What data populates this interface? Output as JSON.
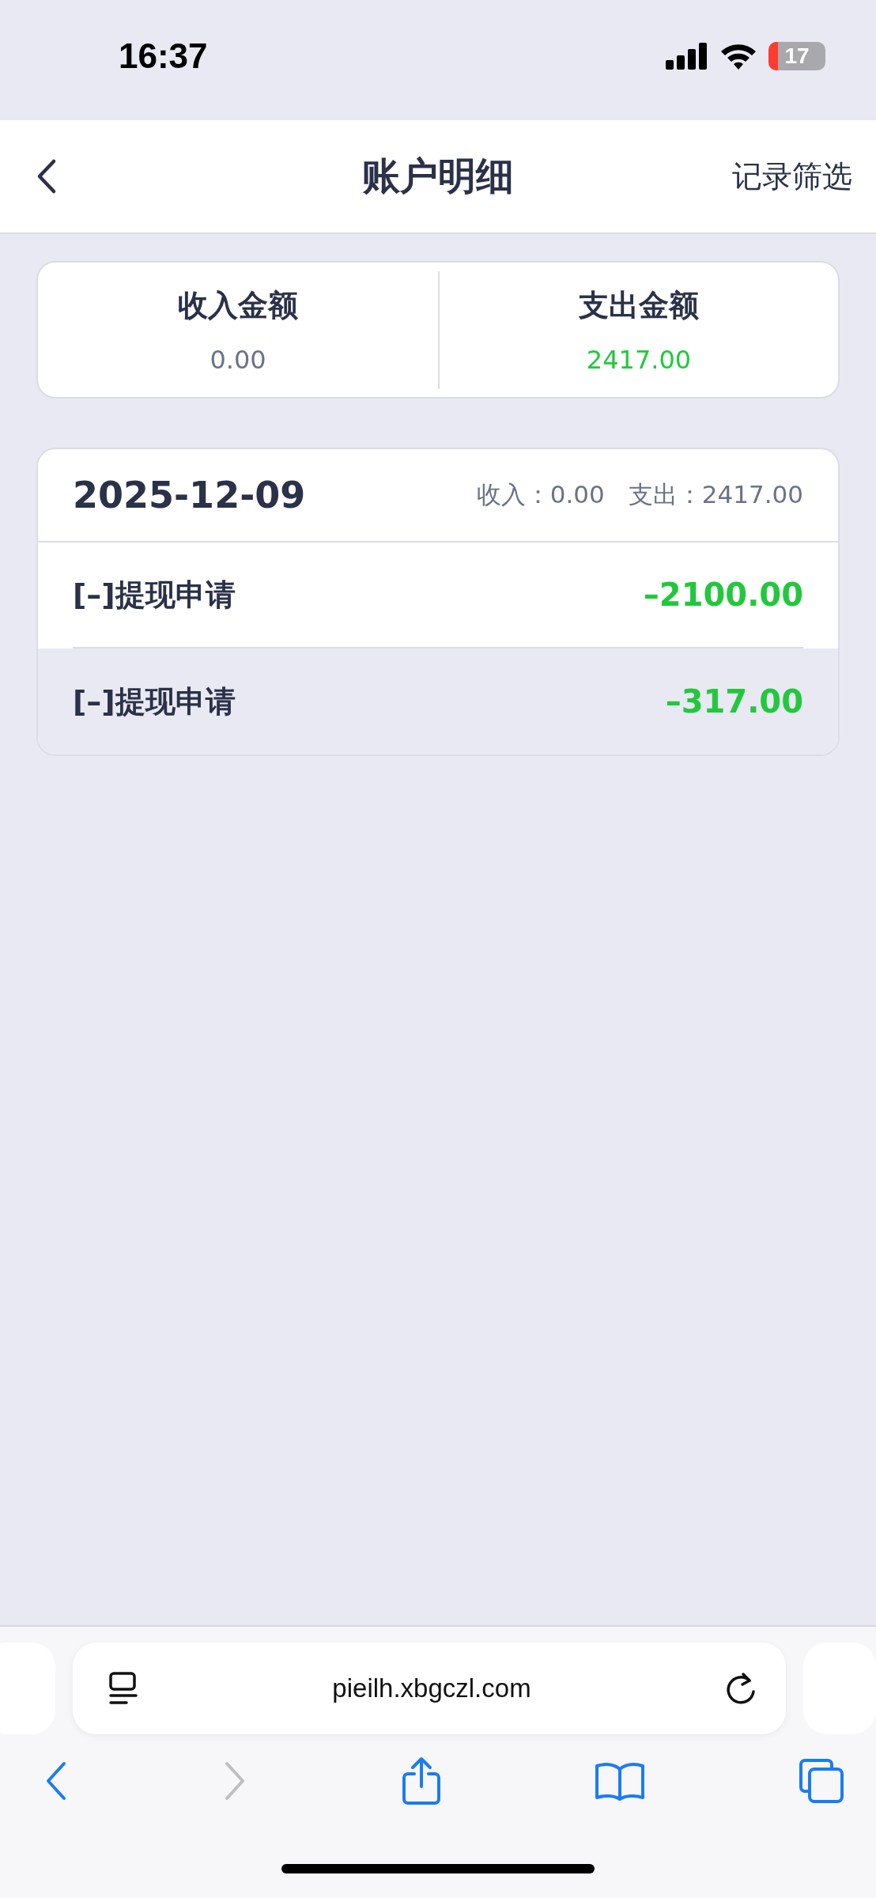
{
  "status_bar": {
    "time": "16:37",
    "battery": "17"
  },
  "nav": {
    "title": "账户明细",
    "action": "记录筛选"
  },
  "summary": [
    {
      "label": "收入金额",
      "value": "0.00",
      "kind": "income"
    },
    {
      "label": "支出金额",
      "value": "2417.00",
      "kind": "expense"
    }
  ],
  "days": [
    {
      "date": "2025-12-09",
      "income_label": "收入：",
      "income": "0.00",
      "expense_label": "支出：",
      "expense": "2417.00",
      "rows": [
        {
          "title": "[–]提现申请",
          "amount": "–2100.00",
          "selected": false
        },
        {
          "title": "[–]提现申请",
          "amount": "–317.00",
          "selected": true
        }
      ]
    }
  ],
  "browser": {
    "url": "pieilh.xbgczl.com"
  }
}
